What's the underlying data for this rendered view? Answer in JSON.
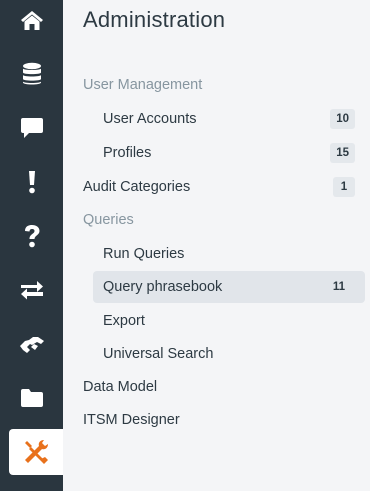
{
  "page": {
    "title": "Administration"
  },
  "rail": {
    "items": [
      {
        "icon": "home-icon"
      },
      {
        "icon": "database-icon"
      },
      {
        "icon": "chat-bubble-icon"
      },
      {
        "icon": "exclamation-icon"
      },
      {
        "icon": "question-icon"
      },
      {
        "icon": "swap-arrows-icon"
      },
      {
        "icon": "handshake-icon"
      },
      {
        "icon": "folder-icon"
      },
      {
        "icon": "tools-icon",
        "active": true
      }
    ],
    "accent_color": "#e8711c"
  },
  "menu": {
    "user_management": "User Management",
    "user_accounts": {
      "label": "User Accounts",
      "count": "10"
    },
    "profiles": {
      "label": "Profiles",
      "count": "15"
    },
    "audit_categories": {
      "label": "Audit Categories",
      "count": "1"
    },
    "queries": "Queries",
    "run_queries": "Run Queries",
    "query_phrasebook": {
      "label": "Query phrasebook",
      "count": "11"
    },
    "export": "Export",
    "universal_search": "Universal Search",
    "data_model": "Data Model",
    "itsm_designer": "ITSM Designer"
  }
}
